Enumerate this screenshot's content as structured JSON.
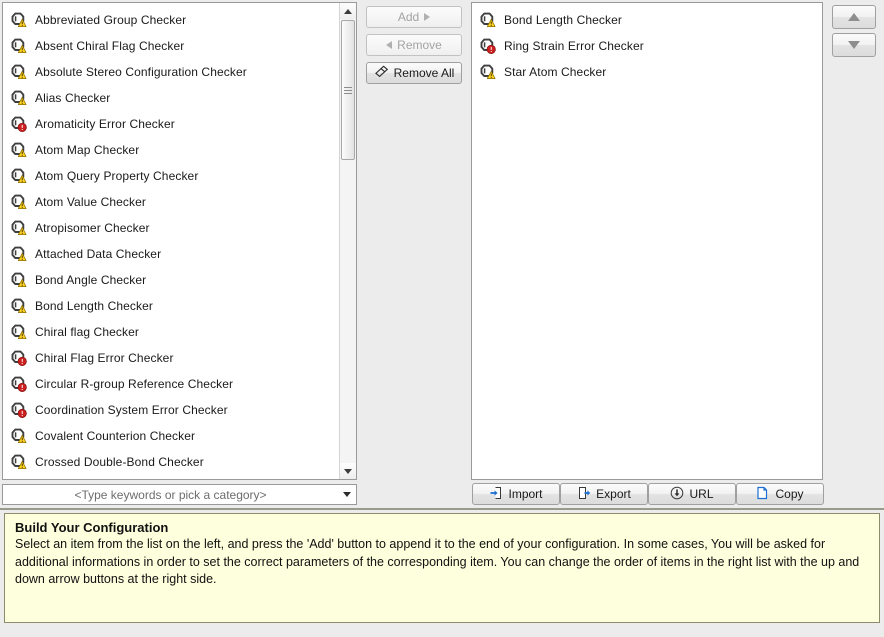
{
  "available_list": {
    "name": "available-checkers-list",
    "items": [
      {
        "label": "Abbreviated Group Checker",
        "badge": "warning"
      },
      {
        "label": "Absent Chiral Flag Checker",
        "badge": "warning"
      },
      {
        "label": "Absolute Stereo Configuration Checker",
        "badge": "warning"
      },
      {
        "label": "Alias Checker",
        "badge": "warning"
      },
      {
        "label": "Aromaticity Error Checker",
        "badge": "error"
      },
      {
        "label": "Atom Map Checker",
        "badge": "warning"
      },
      {
        "label": "Atom Query Property Checker",
        "badge": "warning"
      },
      {
        "label": "Atom Value Checker",
        "badge": "warning"
      },
      {
        "label": "Atropisomer Checker",
        "badge": "warning"
      },
      {
        "label": "Attached Data Checker",
        "badge": "warning"
      },
      {
        "label": "Bond Angle Checker",
        "badge": "warning"
      },
      {
        "label": "Bond Length Checker",
        "badge": "warning"
      },
      {
        "label": "Chiral flag Checker",
        "badge": "warning"
      },
      {
        "label": "Chiral Flag Error Checker",
        "badge": "error"
      },
      {
        "label": "Circular R-group Reference Checker",
        "badge": "error"
      },
      {
        "label": "Coordination System Error Checker",
        "badge": "error"
      },
      {
        "label": "Covalent Counterion Checker",
        "badge": "warning"
      },
      {
        "label": "Crossed Double-Bond Checker",
        "badge": "warning"
      }
    ]
  },
  "filter": {
    "placeholder": "<Type keywords or pick a category>",
    "value": "<Type keywords or pick a category>"
  },
  "transfer_buttons": {
    "add_label": "Add",
    "remove_label": "Remove",
    "remove_all_label": "Remove All",
    "add_enabled": false,
    "remove_enabled": false,
    "remove_all_enabled": true
  },
  "configuration_list": {
    "name": "configuration-checkers-list",
    "items": [
      {
        "label": "Bond Length Checker",
        "badge": "warning"
      },
      {
        "label": "Ring Strain Error Checker",
        "badge": "error"
      },
      {
        "label": "Star Atom Checker",
        "badge": "warning"
      }
    ]
  },
  "order_buttons": {
    "move_up_label": "",
    "move_down_label": "",
    "move_up_enabled": false,
    "move_down_enabled": false
  },
  "io_buttons": [
    {
      "label": "Import",
      "icon": "import-icon"
    },
    {
      "label": "Export",
      "icon": "export-icon"
    },
    {
      "label": "URL",
      "icon": "url-download-icon"
    },
    {
      "label": "Copy",
      "icon": "copy-icon"
    }
  ],
  "info_panel": {
    "title": "Build Your Configuration",
    "body": "Select an item from the list on the left, and press the 'Add' button to append it to the end of your configuration. In some cases, You will be asked for additional informations in order to set the correct parameters of the corresponding item. You can change the order of items in the right list with the up and down arrow buttons at the right side."
  },
  "colors": {
    "warning_badge": "#ffd41f",
    "error_badge": "#cc1f1f",
    "molecule_outline": "#3f3f3f",
    "info_background": "#feffdd",
    "panel_background": "#ececec",
    "accent_blue": "#1f6fd0"
  }
}
